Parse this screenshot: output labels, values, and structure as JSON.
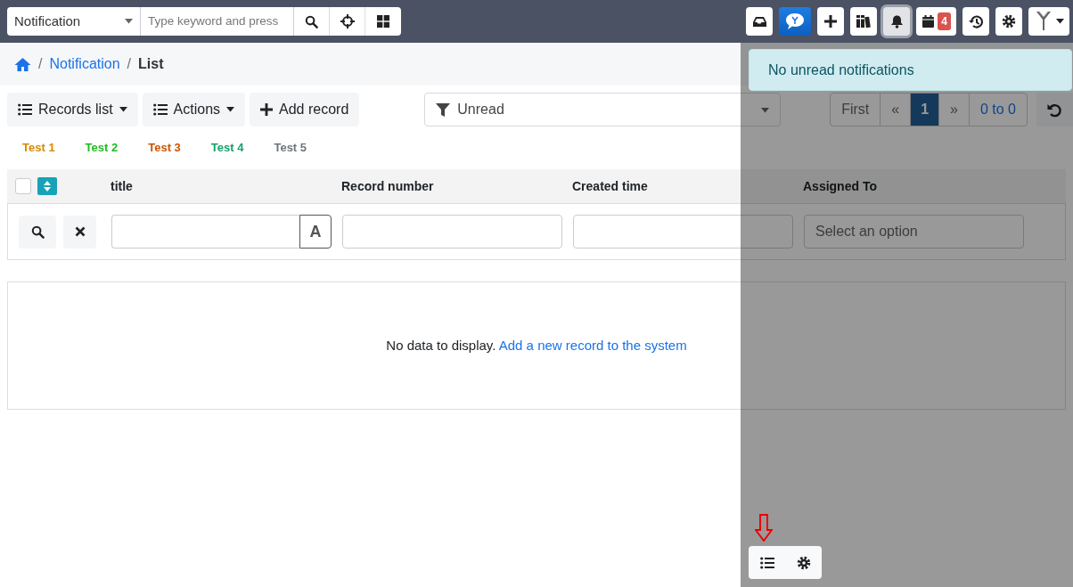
{
  "search_bar": {
    "module": "Notification",
    "placeholder": "Type keyword and press"
  },
  "search_buttons": [
    {
      "kind": "search"
    },
    {
      "kind": "crosshair"
    },
    {
      "kind": "grid"
    }
  ],
  "toolbar_buttons": [
    {
      "kind": "inbox",
      "selected": false
    },
    {
      "kind": "chat",
      "selected": false
    },
    {
      "kind": "plus",
      "selected": false
    },
    {
      "kind": "books",
      "selected": false
    },
    {
      "kind": "bell",
      "selected": true
    },
    {
      "kind": "calendar",
      "selected": false,
      "badge": "4"
    },
    {
      "kind": "history",
      "selected": false
    },
    {
      "kind": "gear",
      "selected": false
    },
    {
      "kind": "logo",
      "selected": false
    }
  ],
  "breadcrumb": {
    "separator": "/",
    "link": "Notification",
    "current": "List"
  },
  "action_buttons": [
    {
      "kind": "dropdown",
      "label": "Records list"
    },
    {
      "kind": "dropdown",
      "label": "Actions"
    },
    {
      "kind": "add",
      "label": "Add record"
    }
  ],
  "filter": {
    "value": "Unread"
  },
  "pagination": {
    "first": "First",
    "prev": "«",
    "pages": [
      {
        "label": "1",
        "selected": true
      }
    ],
    "next": "»",
    "range": "0 to 0"
  },
  "tabs": [
    {
      "label": "Test 1",
      "color": "#d68a00"
    },
    {
      "label": "Test 2",
      "color": "#22bb22"
    },
    {
      "label": "Test 3",
      "color": "#cc5500"
    },
    {
      "label": "Test 4",
      "color": "#14a06a"
    },
    {
      "label": "Test 5",
      "color": "#6c757d"
    }
  ],
  "table": {
    "select_all": {
      "checked": false
    },
    "columns": [
      {
        "label": "title",
        "filter": {
          "kind": "text-toggle",
          "toggle": "A"
        }
      },
      {
        "label": "Record number",
        "filter": {
          "kind": "text"
        }
      },
      {
        "label": "Created time",
        "filter": {
          "kind": "text"
        }
      },
      {
        "label": "Assigned To",
        "filter": {
          "kind": "select",
          "placeholder": "Select an option"
        }
      }
    ],
    "empty_text": "No data to display.",
    "empty_link": "Add a new record to the system"
  },
  "notification_panel": {
    "message": "No unread notifications",
    "footer_buttons": [
      {
        "kind": "list"
      },
      {
        "kind": "gear"
      }
    ]
  }
}
